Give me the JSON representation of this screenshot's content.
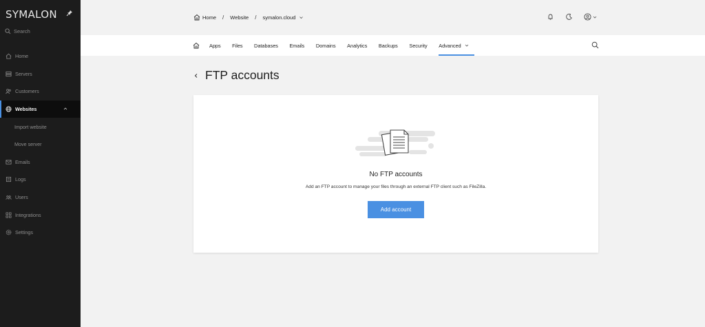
{
  "brand": "SYMALON",
  "search_label": "Search",
  "sidebar": {
    "items": [
      {
        "label": "Home"
      },
      {
        "label": "Servers"
      },
      {
        "label": "Customers"
      },
      {
        "label": "Websites"
      },
      {
        "label": "Import website"
      },
      {
        "label": "Move server"
      },
      {
        "label": "Emails"
      },
      {
        "label": "Logs"
      },
      {
        "label": "Users"
      },
      {
        "label": "Integrations"
      },
      {
        "label": "Settings"
      }
    ]
  },
  "breadcrumb": {
    "home": "Home",
    "website": "Website",
    "domain": "symalon.cloud"
  },
  "tabs": [
    "Apps",
    "Files",
    "Databases",
    "Emails",
    "Domains",
    "Analytics",
    "Backups",
    "Security",
    "Advanced"
  ],
  "page": {
    "title": "FTP accounts"
  },
  "empty_state": {
    "title": "No FTP accounts",
    "description": "Add an FTP account to manage your files through an external FTP client such as FileZilla.",
    "button_label": "Add account"
  },
  "colors": {
    "accent": "#4a90e2",
    "sidebar_bg": "#1c1c1c"
  }
}
